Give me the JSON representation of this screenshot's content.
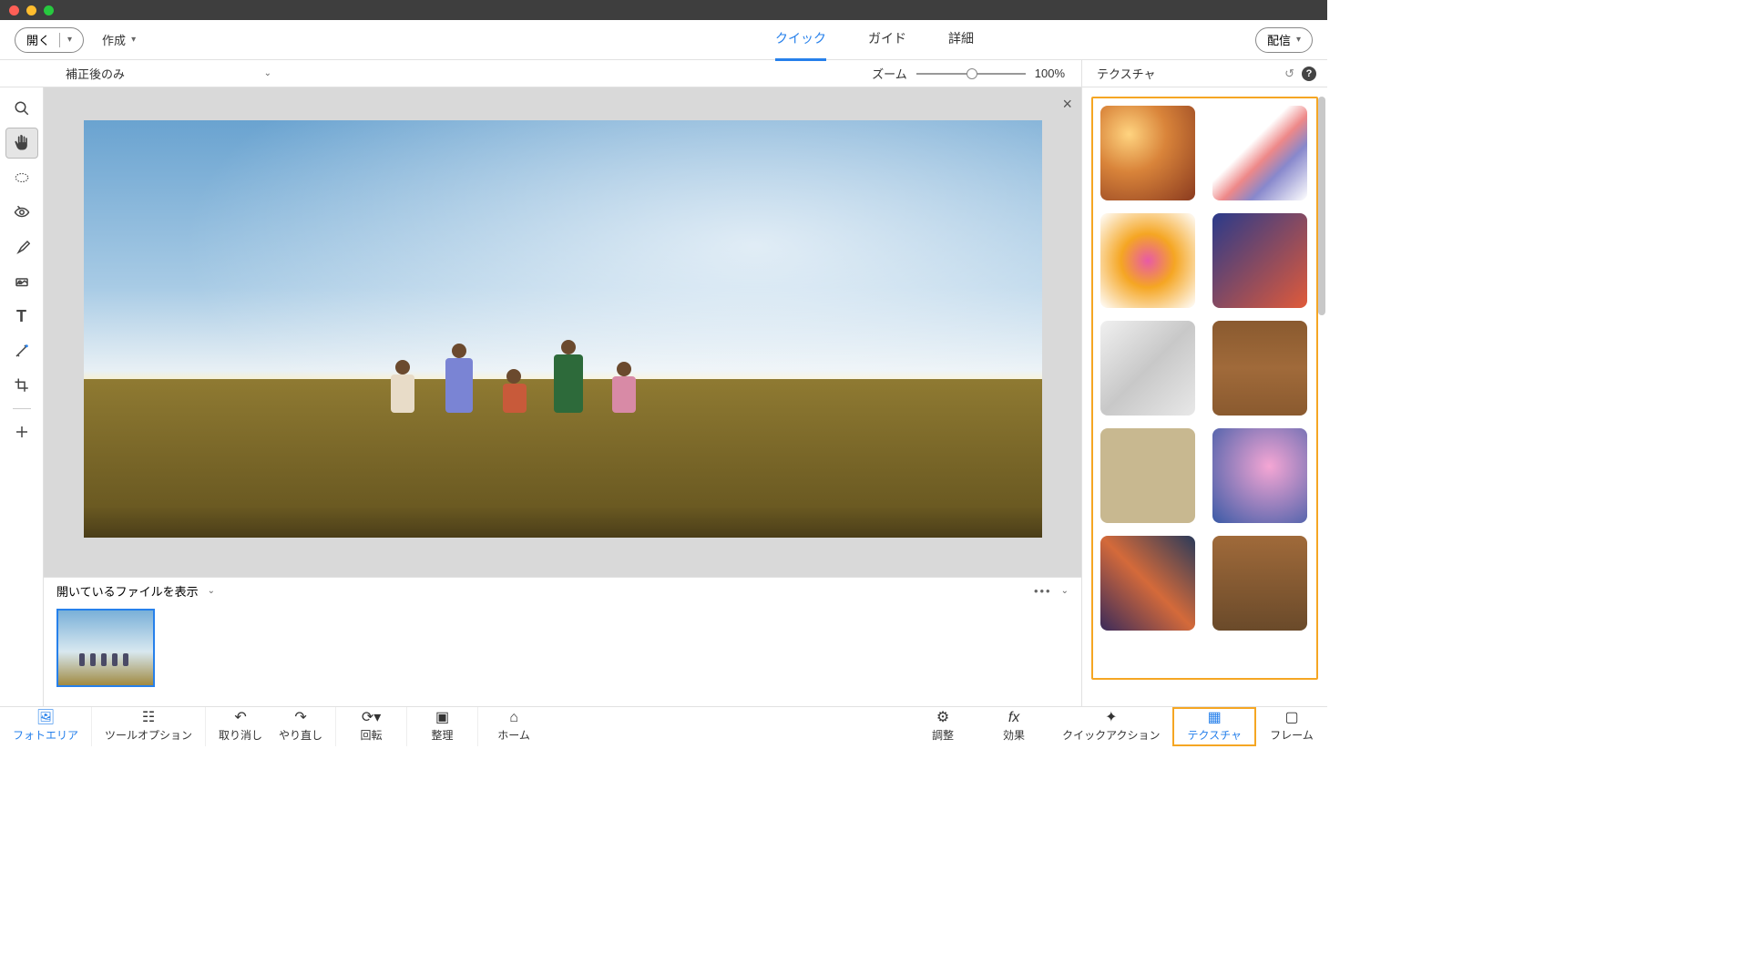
{
  "titlebar": {},
  "toolbar": {
    "open_label": "開く",
    "create_label": "作成",
    "share_label": "配信"
  },
  "tabs": {
    "quick": "クイック",
    "guide": "ガイド",
    "advanced": "詳細",
    "active": "quick"
  },
  "subheader": {
    "view_mode": "補正後のみ",
    "zoom_label": "ズーム",
    "zoom_value": "100%"
  },
  "right_panel": {
    "title": "テクスチャ",
    "textures": [
      "bokeh-hearts",
      "ink-splash",
      "color-burst",
      "gradient-sunset",
      "light-rays",
      "wood-grain",
      "kraft-paper",
      "bokeh-blue",
      "geometric",
      "wood-planks"
    ]
  },
  "tools": [
    "zoom",
    "hand",
    "quick-select",
    "red-eye",
    "brush",
    "spot-heal",
    "text",
    "magic-wand",
    "crop",
    "move"
  ],
  "tool_selected": "hand",
  "canvas": {
    "close": "×"
  },
  "filmstrip": {
    "header": "開いているファイルを表示",
    "thumbs": 1
  },
  "bottom": {
    "photo_area": "フォトエリア",
    "tool_options": "ツールオプション",
    "undo": "取り消し",
    "redo": "やり直し",
    "rotate": "回転",
    "organize": "整理",
    "home": "ホーム",
    "adjust": "調整",
    "effects": "効果",
    "quick_action": "クイックアクション",
    "texture": "テクスチャ",
    "frame": "フレーム",
    "active": "photo_area",
    "highlighted": "texture"
  }
}
